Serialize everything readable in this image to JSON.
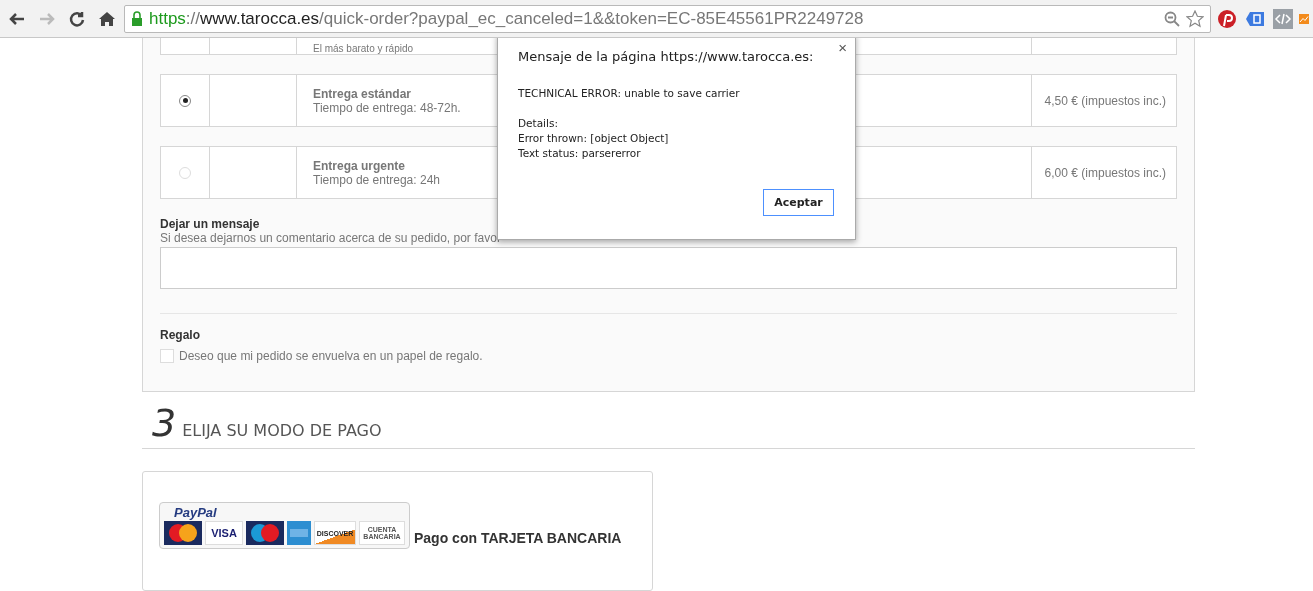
{
  "browser": {
    "back_disabled": false,
    "forward_disabled": true,
    "url": {
      "scheme": "https",
      "separator": "://",
      "host": "www.tarocca.es",
      "path": "/quick-order?paypal_ec_canceled=1&&token=EC-85E45561PR2249728"
    }
  },
  "carriers": [
    {
      "delay": "El más barato y rápido",
      "kind": "partial"
    },
    {
      "name": "Entrega estándar",
      "delay": "Tiempo de entrega: 48-72h.",
      "price": "4,50 € (impuestos inc.)",
      "selected": true,
      "kind": "full"
    },
    {
      "name": "Entrega urgente",
      "delay": "Tiempo de entrega: 24h",
      "price": "6,00 € (impuestos inc.)",
      "selected": false,
      "kind": "full"
    }
  ],
  "message": {
    "title": "Dejar un mensaje",
    "hint": "Si desea dejarnos un comentario acerca de su pedido, por favor"
  },
  "gift": {
    "title": "Regalo",
    "label": "Deseo que mi pedido se envuelva en un papel de regalo.",
    "checked": false
  },
  "payment_section": {
    "number": "3",
    "title": "ELIJA SU MODO DE PAGO"
  },
  "payment_option": {
    "brand": "PayPal",
    "card_label": "VISA",
    "discover_label": "DISCOVER",
    "account_label": "CUENTA BANCARIA",
    "label": "Pago con TARJETA BANCARIA"
  },
  "dialog": {
    "title": "Mensaje de la página https://www.tarocca.es:",
    "close": "×",
    "message": "TECHNICAL ERROR: unable to save carrier",
    "details": [
      "Details:",
      "Error thrown: [object Object]",
      "Text status: parsererror"
    ],
    "button": "Aceptar"
  }
}
